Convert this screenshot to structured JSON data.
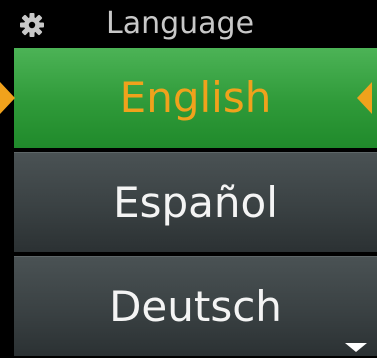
{
  "header": {
    "title": "Language",
    "icon": "gear-icon"
  },
  "languages": [
    {
      "label": "English",
      "selected": true
    },
    {
      "label": "Español",
      "selected": false
    },
    {
      "label": "Deutsch",
      "selected": false
    }
  ],
  "colors": {
    "selected_background": "#2f9a39",
    "selected_text": "#f0a21c",
    "item_background": "#3a4143",
    "item_text": "#f4f4f4",
    "header_text": "#c8c8c8"
  },
  "indicators": {
    "left_arrow": "left-arrow-icon",
    "right_arrow": "right-arrow-icon",
    "scroll_down": "scroll-down-icon"
  }
}
